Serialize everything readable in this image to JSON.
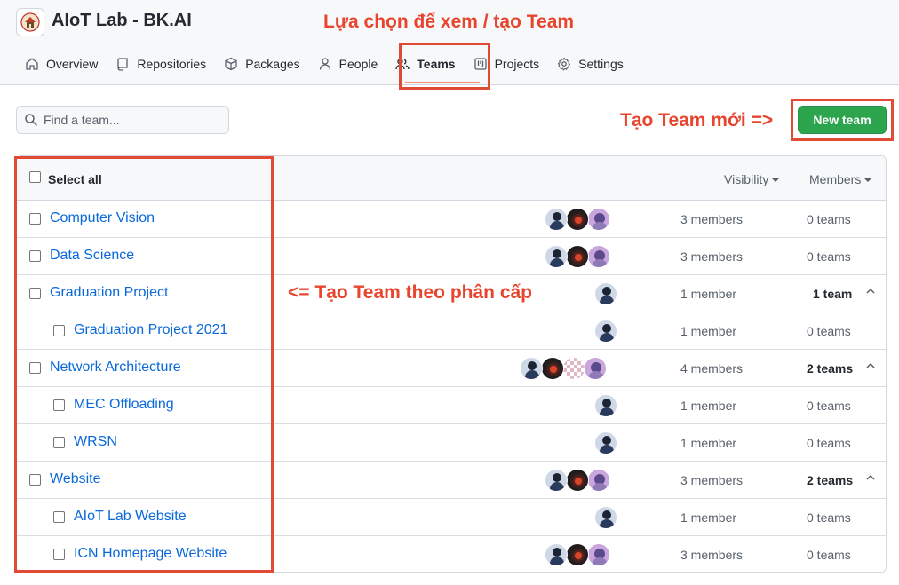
{
  "org": {
    "name": "AIoT Lab - BK.AI"
  },
  "annotations": {
    "top": "Lựa chọn để xem / tạo Team",
    "new_team": "Tạo Team mới =>",
    "hierarchy": "<= Tạo Team theo phân cấp"
  },
  "nav": [
    {
      "label": "Overview",
      "icon": "book-icon"
    },
    {
      "label": "Repositories",
      "icon": "repo-icon"
    },
    {
      "label": "Packages",
      "icon": "package-icon"
    },
    {
      "label": "People",
      "icon": "person-icon"
    },
    {
      "label": "Teams",
      "icon": "people-icon",
      "active": true
    },
    {
      "label": "Projects",
      "icon": "project-icon"
    },
    {
      "label": "Settings",
      "icon": "gear-icon"
    }
  ],
  "search": {
    "placeholder": "Find a team..."
  },
  "new_team_label": "New team",
  "table": {
    "select_all": "Select all",
    "visibility": "Visibility",
    "members_header": "Members",
    "rows": [
      {
        "name": "Computer Vision",
        "members": "3 members",
        "teams": "0 teams",
        "level": 0,
        "avatars": [
          "a",
          "b",
          "c"
        ]
      },
      {
        "name": "Data Science",
        "members": "3 members",
        "teams": "0 teams",
        "level": 0,
        "avatars": [
          "a",
          "b",
          "c"
        ]
      },
      {
        "name": "Graduation Project",
        "members": "1 member",
        "teams": "1 team",
        "level": 0,
        "expanded": true,
        "avatars": [
          "a"
        ]
      },
      {
        "name": "Graduation Project 2021",
        "members": "1 member",
        "teams": "0 teams",
        "level": 1,
        "avatars": [
          "a"
        ]
      },
      {
        "name": "Network Architecture",
        "members": "4 members",
        "teams": "2 teams",
        "level": 0,
        "expanded": true,
        "avatars": [
          "a",
          "b",
          "d",
          "c"
        ]
      },
      {
        "name": "MEC Offloading",
        "members": "1 member",
        "teams": "0 teams",
        "level": 1,
        "avatars": [
          "a"
        ]
      },
      {
        "name": "WRSN",
        "members": "1 member",
        "teams": "0 teams",
        "level": 1,
        "avatars": [
          "a"
        ]
      },
      {
        "name": "Website",
        "members": "3 members",
        "teams": "2 teams",
        "level": 0,
        "expanded": true,
        "avatars": [
          "a",
          "b",
          "c"
        ]
      },
      {
        "name": "AIoT Lab Website",
        "members": "1 member",
        "teams": "0 teams",
        "level": 1,
        "avatars": [
          "a"
        ]
      },
      {
        "name": "ICN Homepage Website",
        "members": "3 members",
        "teams": "0 teams",
        "level": 1,
        "avatars": [
          "a",
          "b",
          "c"
        ]
      }
    ]
  },
  "colors": {
    "accent": "#0969da",
    "primary_button": "#2da44e",
    "annotation": "#e8452f",
    "tab_underline": "#fd8c73"
  }
}
